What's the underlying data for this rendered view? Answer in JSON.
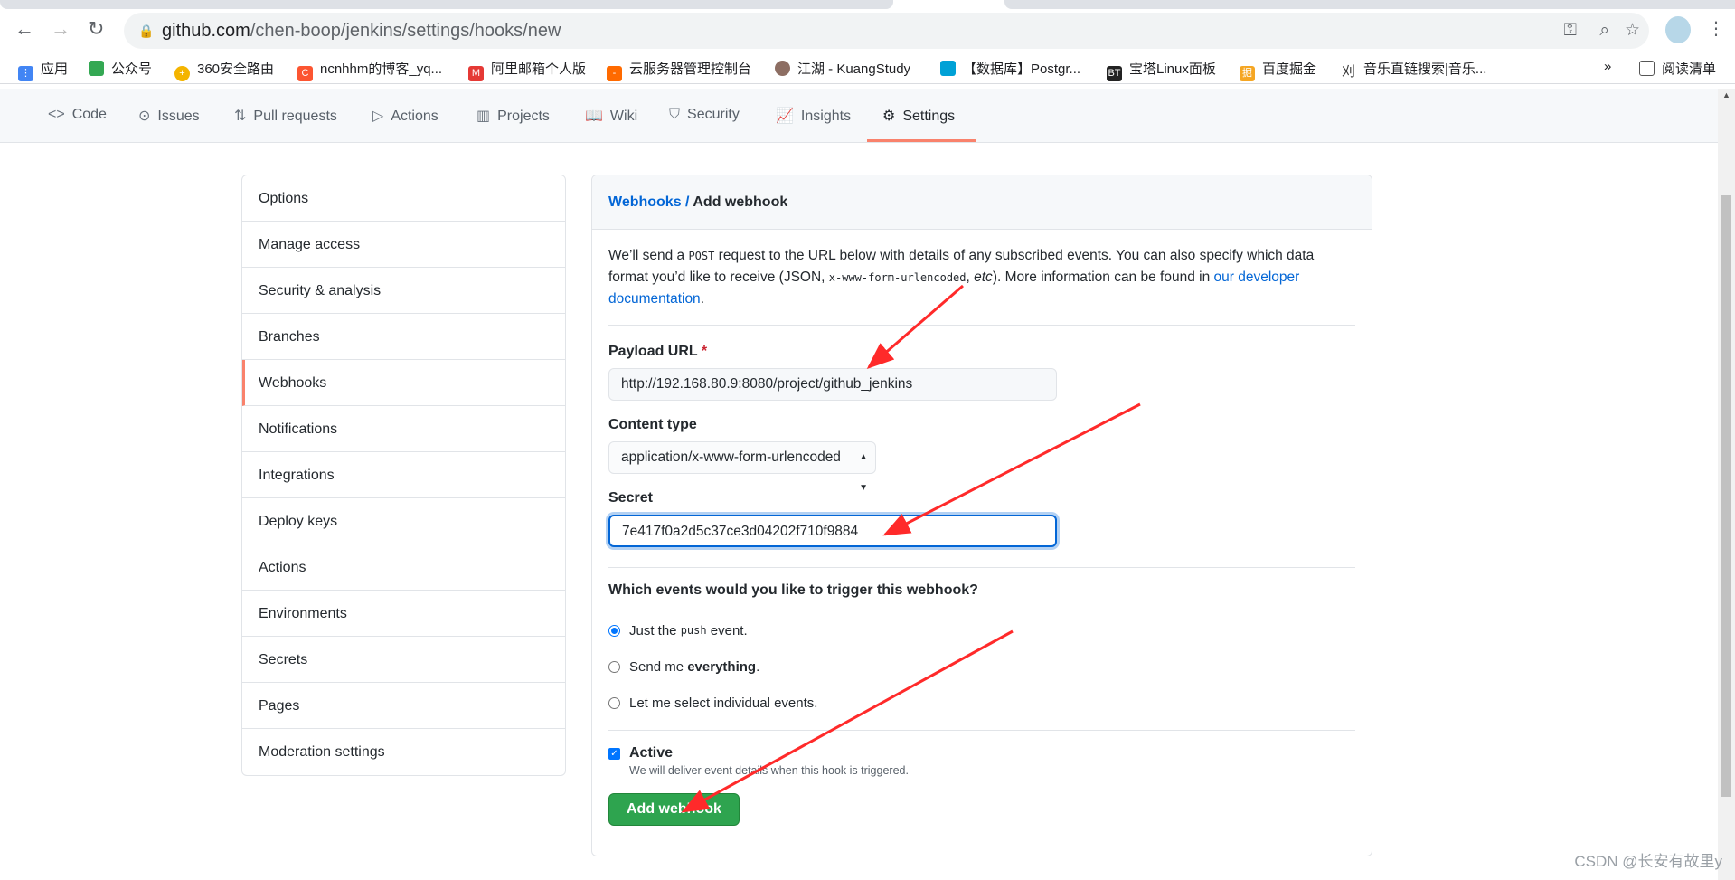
{
  "browser": {
    "url_host": "github.com",
    "url_path": "/chen-boop/jenkins/settings/hooks/new",
    "bookmarks": [
      {
        "label": "应用",
        "color": "#ea4335"
      },
      {
        "label": "公众号",
        "color": "#34a853"
      },
      {
        "label": "360安全路由",
        "color": "#f4b400"
      },
      {
        "label": "ncnhhm的博客_yq...",
        "color": "#fc5531"
      },
      {
        "label": "阿里邮箱个人版",
        "color": "#e53935"
      },
      {
        "label": "云服务器管理控制台",
        "color": "#ff6a00"
      },
      {
        "label": "江湖 - KuangStudy",
        "color": "#8d6e63"
      },
      {
        "label": "【数据库】Postgr...",
        "color": "#00a1d6"
      },
      {
        "label": "宝塔Linux面板",
        "color": "#222222"
      },
      {
        "label": "百度掘金",
        "color": "#f5a623"
      },
      {
        "label": "音乐直链搜索|音乐...",
        "color": "#333333"
      }
    ],
    "overflow": "»",
    "reading_list": "阅读清单"
  },
  "repo_nav": [
    {
      "label": "Code",
      "icon": "<>"
    },
    {
      "label": "Issues",
      "icon": "⊙"
    },
    {
      "label": "Pull requests",
      "icon": "⇅"
    },
    {
      "label": "Actions",
      "icon": "▷"
    },
    {
      "label": "Projects",
      "icon": "▥"
    },
    {
      "label": "Wiki",
      "icon": "📖"
    },
    {
      "label": "Security",
      "icon": "⛉"
    },
    {
      "label": "Insights",
      "icon": "📈"
    },
    {
      "label": "Settings",
      "icon": "⚙"
    }
  ],
  "sidebar": [
    "Options",
    "Manage access",
    "Security & analysis",
    "Branches",
    "Webhooks",
    "Notifications",
    "Integrations",
    "Deploy keys",
    "Actions",
    "Environments",
    "Secrets",
    "Pages",
    "Moderation settings"
  ],
  "panel": {
    "crumb_link": "Webhooks",
    "crumb_sep": " / ",
    "crumb_current": "Add webhook",
    "desc_1": "We’ll send a ",
    "desc_post": "POST",
    "desc_2": " request to the URL below with details of any subscribed events. You can also specify which data format you’d like to receive (JSON, ",
    "desc_code": "x-www-form-urlencoded",
    "desc_3": ", ",
    "desc_etc": "etc",
    "desc_4": "). More information can be found in ",
    "desc_link": "our developer documentation",
    "desc_5": ".",
    "payload_label": "Payload URL",
    "required": "*",
    "payload_value": "http://192.168.80.9:8080/project/github_jenkins",
    "content_type_label": "Content type",
    "content_type_value": "application/x-www-form-urlencoded",
    "secret_label": "Secret",
    "secret_value": "7e417f0a2d5c37ce3d04202f710f9884",
    "events_question": "Which events would you like to trigger this webhook?",
    "opt1_a": "Just the ",
    "opt1_code": "push",
    "opt1_b": " event.",
    "opt2_a": "Send me ",
    "opt2_b": "everything",
    ".opt2_c": ".",
    "opt3": "Let me select individual events.",
    "active_label": "Active",
    "active_note": "We will deliver event details when this hook is triggered.",
    "submit": "Add webhook"
  },
  "watermark": "CSDN @长安有故里y",
  "colors": {
    "accent": "#0366d6",
    "selected": "#f9826c",
    "button": "#2ea44f",
    "arrow": "#ff2a2a"
  }
}
